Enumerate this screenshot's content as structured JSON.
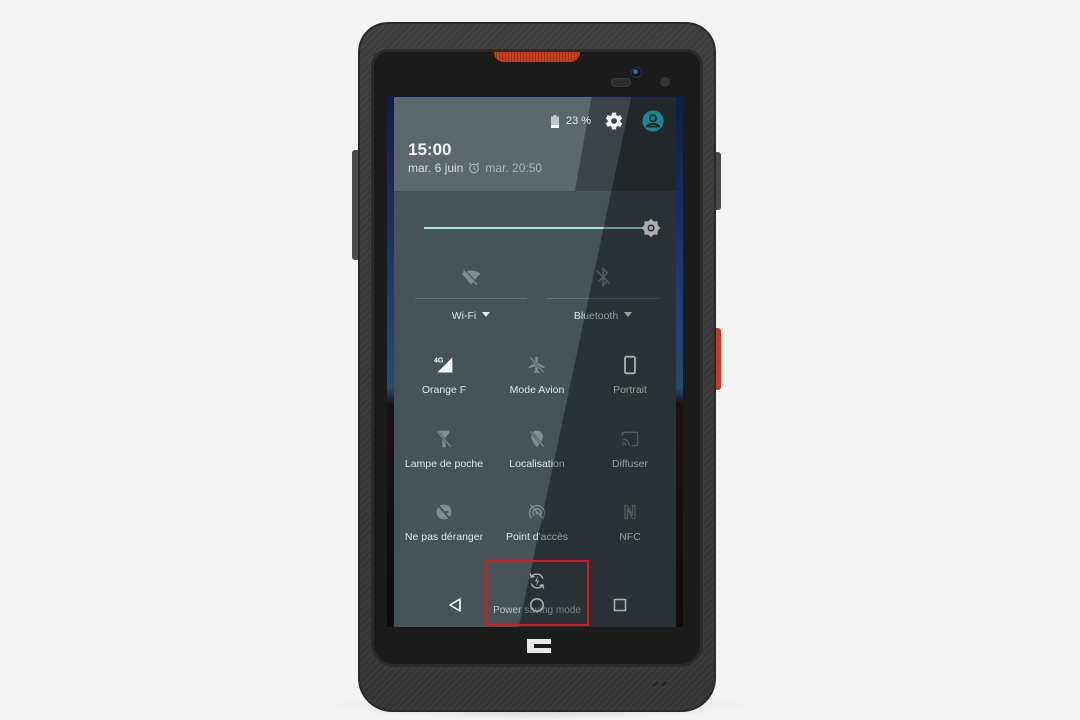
{
  "device": {
    "type": "rugged-smartphone",
    "accent_color": "#d4361f"
  },
  "status": {
    "battery_percent_label": "23 %",
    "battery_level": 0.23
  },
  "header": {
    "time": "15:00",
    "date": "mar. 6 juin",
    "next_alarm": "mar. 20:50",
    "settings_icon": "gear-icon",
    "user_icon": "account-circle-icon",
    "user_icon_color": "#1ec8dc"
  },
  "brightness": {
    "level": 1.0,
    "track_color": "#9fe0de"
  },
  "quick_settings": {
    "large_tiles": [
      {
        "label": "Wi-Fi",
        "icon": "wifi-off-icon",
        "has_dropdown": true
      },
      {
        "label": "Bluetooth",
        "icon": "bluetooth-off-icon",
        "has_dropdown": true
      }
    ],
    "tiles": [
      {
        "label": "Orange F",
        "icon": "cellular-4g-icon",
        "badge": "4G"
      },
      {
        "label": "Mode Avion",
        "icon": "airplane-off-icon"
      },
      {
        "label": "Portrait",
        "icon": "screen-portrait-icon"
      },
      {
        "label": "Lampe de poche",
        "icon": "flashlight-off-icon"
      },
      {
        "label": "Localisation",
        "icon": "location-off-icon"
      },
      {
        "label": "Diffuser",
        "icon": "cast-icon"
      },
      {
        "label": "Ne pas déranger",
        "icon": "do-not-disturb-off-icon"
      },
      {
        "label": "Point d'accès",
        "icon": "hotspot-off-icon"
      },
      {
        "label": "NFC",
        "icon": "nfc-icon"
      }
    ],
    "highlighted_tile": {
      "label": "Power saving mode",
      "icon": "power-saving-icon"
    }
  },
  "navigation": {
    "back": "back-icon",
    "home": "home-icon",
    "recents": "recents-icon"
  },
  "annotation": {
    "highlight_color": "#e0161d",
    "target": "Power saving mode"
  }
}
